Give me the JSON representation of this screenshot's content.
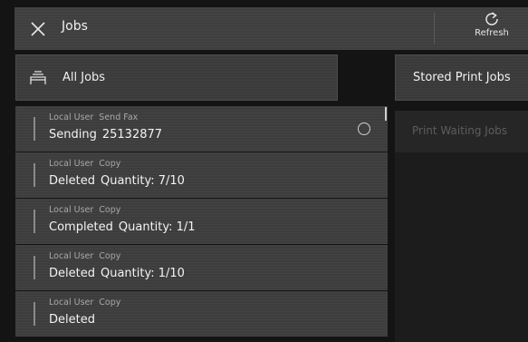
{
  "header": {
    "title": "Jobs",
    "close_icon": "close-icon",
    "refresh_label": "Refresh",
    "refresh_icon": "refresh-icon"
  },
  "filter": {
    "label": "All Jobs",
    "icon": "job-stack-icon"
  },
  "tabs": {
    "stored": "Stored Print Jobs",
    "waiting": "Print Waiting Jobs"
  },
  "jobs": [
    {
      "user": "Local User",
      "function": "Send Fax",
      "status": "Sending",
      "detail": "25132877",
      "in_progress": true
    },
    {
      "user": "Local User",
      "function": "Copy",
      "status": "Deleted",
      "detail": "Quantity: 7/10"
    },
    {
      "user": "Local User",
      "function": "Copy",
      "status": "Completed",
      "detail": "Quantity: 1/1"
    },
    {
      "user": "Local User",
      "function": "Copy",
      "status": "Deleted",
      "detail": "Quantity: 1/10"
    },
    {
      "user": "Local User",
      "function": "Copy",
      "status": "Deleted",
      "detail": ""
    }
  ],
  "colors": {
    "background": "#141414",
    "header": "#3f3f3f",
    "row": "#3d3d3d",
    "disabled_text": "#5d5d5d"
  }
}
